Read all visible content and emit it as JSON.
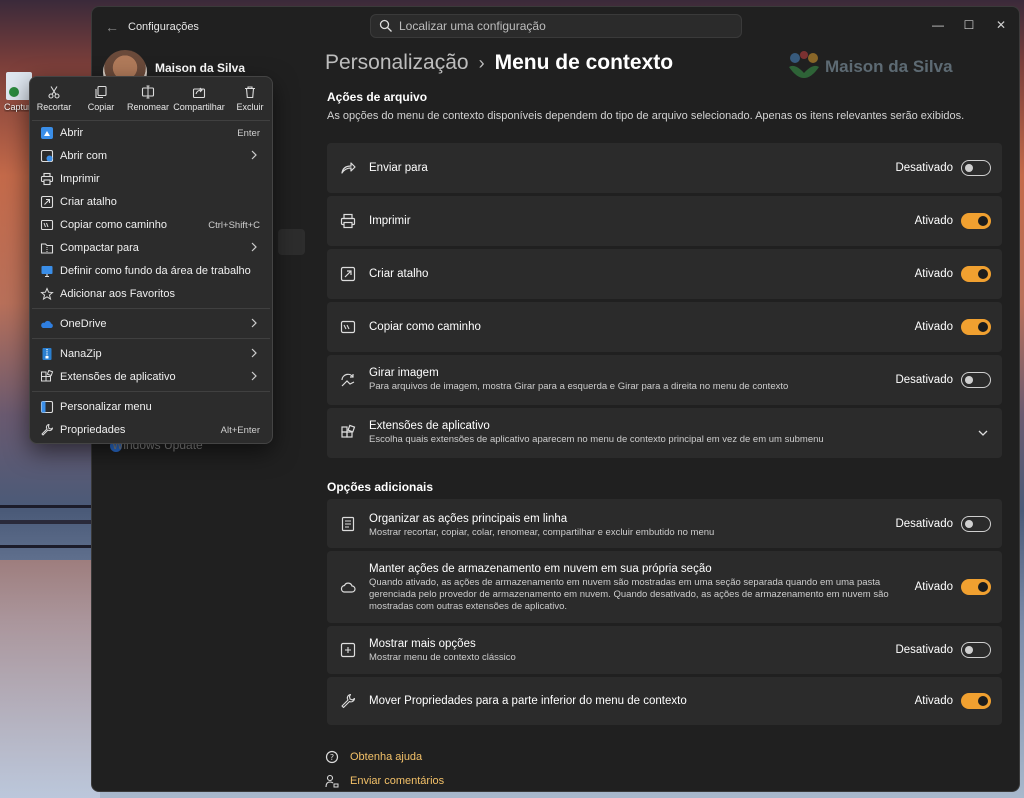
{
  "desktop": {
    "icon_label": "Captura teia co"
  },
  "window": {
    "title": "Configurações",
    "search_placeholder": "Localizar uma configuração",
    "controls": {
      "minimize": "—",
      "maximize": "☐",
      "close": "✕"
    }
  },
  "profile": {
    "name": "Maison da Silva"
  },
  "nav": {
    "windows_update": "Windows Update"
  },
  "breadcrumb": {
    "parent": "Personalização",
    "separator": "›",
    "current": "Menu de contexto"
  },
  "watermark": {
    "text": "Maison da Silva"
  },
  "file_actions": {
    "title": "Ações de arquivo",
    "description": "As opções do menu de contexto disponíveis dependem do tipo de arquivo selecionado. Apenas os itens relevantes serão exibidos.",
    "items": [
      {
        "title": "Enviar para",
        "subtitle": "",
        "state": "Desativado",
        "enabled": false,
        "icon": "share-arrow-icon"
      },
      {
        "title": "Imprimir",
        "subtitle": "",
        "state": "Ativado",
        "enabled": true,
        "icon": "printer-icon"
      },
      {
        "title": "Criar atalho",
        "subtitle": "",
        "state": "Ativado",
        "enabled": true,
        "icon": "shortcut-icon"
      },
      {
        "title": "Copiar como caminho",
        "subtitle": "",
        "state": "Ativado",
        "enabled": true,
        "icon": "copy-path-icon"
      },
      {
        "title": "Girar imagem",
        "subtitle": "Para arquivos de imagem, mostra Girar para a esquerda e Girar para a direita no menu de contexto",
        "state": "Desativado",
        "enabled": false,
        "icon": "rotate-image-icon"
      },
      {
        "title": "Extensões de aplicativo",
        "subtitle": "Escolha quais extensões de aplicativo aparecem no menu de contexto principal em vez de em um submenu",
        "state": "",
        "icon": "extensions-icon"
      }
    ]
  },
  "additional": {
    "title": "Opções adicionais",
    "items": [
      {
        "title": "Organizar as ações principais em linha",
        "subtitle": "Mostrar recortar, copiar, colar, renomear, compartilhar e excluir embutido no menu",
        "state": "Desativado",
        "enabled": false,
        "icon": "inline-actions-icon"
      },
      {
        "title": "Manter ações de armazenamento em nuvem em sua própria seção",
        "subtitle": "Quando ativado, as ações de armazenamento em nuvem são mostradas em uma seção separada quando em uma pasta gerenciada pelo provedor de armazenamento em nuvem. Quando desativado, as ações de armazenamento em nuvem são mostradas com outras extensões de aplicativo.",
        "state": "Ativado",
        "enabled": true,
        "icon": "cloud-icon"
      },
      {
        "title": "Mostrar mais opções",
        "subtitle": "Mostrar menu de contexto clássico",
        "state": "Desativado",
        "enabled": false,
        "icon": "more-options-icon"
      },
      {
        "title": "Mover Propriedades para a parte inferior do menu de contexto",
        "subtitle": "",
        "state": "Ativado",
        "enabled": true,
        "icon": "wrench-icon"
      }
    ]
  },
  "footer": {
    "help": "Obtenha ajuda",
    "feedback": "Enviar comentários"
  },
  "context_menu": {
    "toolbar": [
      "Recortar",
      "Copiar",
      "Renomear",
      "Compartilhar",
      "Excluir"
    ],
    "items": [
      {
        "label": "Abrir",
        "shortcut": "Enter",
        "submenu": false,
        "icon": "open-app-icon"
      },
      {
        "label": "Abrir com",
        "shortcut": "",
        "submenu": true,
        "icon": "open-with-icon"
      },
      {
        "label": "Imprimir",
        "shortcut": "",
        "submenu": false,
        "icon": "printer-icon"
      },
      {
        "label": "Criar atalho",
        "shortcut": "",
        "submenu": false,
        "icon": "shortcut-icon"
      },
      {
        "label": "Copiar como caminho",
        "shortcut": "Ctrl+Shift+C",
        "submenu": false,
        "icon": "copy-path-icon"
      },
      {
        "label": "Compactar para",
        "shortcut": "",
        "submenu": true,
        "icon": "zip-icon"
      },
      {
        "label": "Definir como fundo da área de trabalho",
        "shortcut": "",
        "submenu": false,
        "icon": "wallpaper-icon"
      },
      {
        "label": "Adicionar aos Favoritos",
        "shortcut": "",
        "submenu": false,
        "icon": "star-icon"
      },
      {
        "label": "OneDrive",
        "shortcut": "",
        "submenu": true,
        "icon": "onedrive-icon"
      },
      {
        "label": "NanaZip",
        "shortcut": "",
        "submenu": true,
        "icon": "nanazip-icon"
      },
      {
        "label": "Extensões de aplicativo",
        "shortcut": "",
        "submenu": true,
        "icon": "extensions-icon"
      },
      {
        "label": "Personalizar menu",
        "shortcut": "",
        "submenu": false,
        "icon": "customize-icon"
      },
      {
        "label": "Propriedades",
        "shortcut": "Alt+Enter",
        "submenu": false,
        "icon": "wrench-icon"
      }
    ]
  },
  "colors": {
    "accent": "#f0a030",
    "window_bg": "#202020",
    "card_bg": "#2b2b2b",
    "link": "#f2c068"
  }
}
